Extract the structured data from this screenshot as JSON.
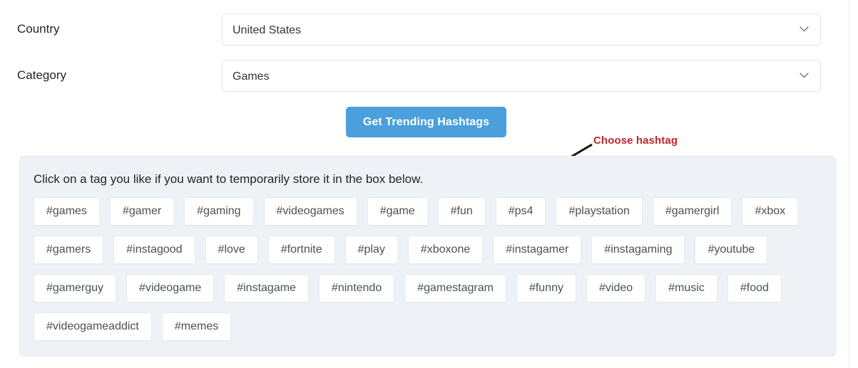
{
  "form": {
    "fields": [
      {
        "label": "Country",
        "value": "United States",
        "icon": "chevron-down-icon"
      },
      {
        "label": "Category",
        "value": "Games",
        "icon": "chevron-down-icon"
      }
    ]
  },
  "submit": {
    "label": "Get Trending Hashtags",
    "color": "#4a9fdc"
  },
  "annotation": {
    "label": "Choose hashtag",
    "color": "#c0272d",
    "arrow": "arrow-down-left-icon"
  },
  "tags_panel": {
    "hint": "Click on a tag you like if you want to temporarily store it in the box below.",
    "background": "#eef1f6",
    "rows": [
      [
        "#games",
        "#gamer",
        "#gaming",
        "#videogames",
        "#game",
        "#fun",
        "#ps4",
        "#playstation",
        "#gamergirl",
        "#xbox"
      ],
      [
        "#gamers",
        "#instagood",
        "#love",
        "#fortnite",
        "#play",
        "#xboxone",
        "#instagamer",
        "#instagaming",
        "#youtube"
      ],
      [
        "#gamerguy",
        "#videogame",
        "#instagame",
        "#nintendo",
        "#gamestagram",
        "#funny",
        "#video",
        "#music",
        "#food"
      ],
      [
        "#videogameaddict",
        "#memes"
      ]
    ]
  }
}
